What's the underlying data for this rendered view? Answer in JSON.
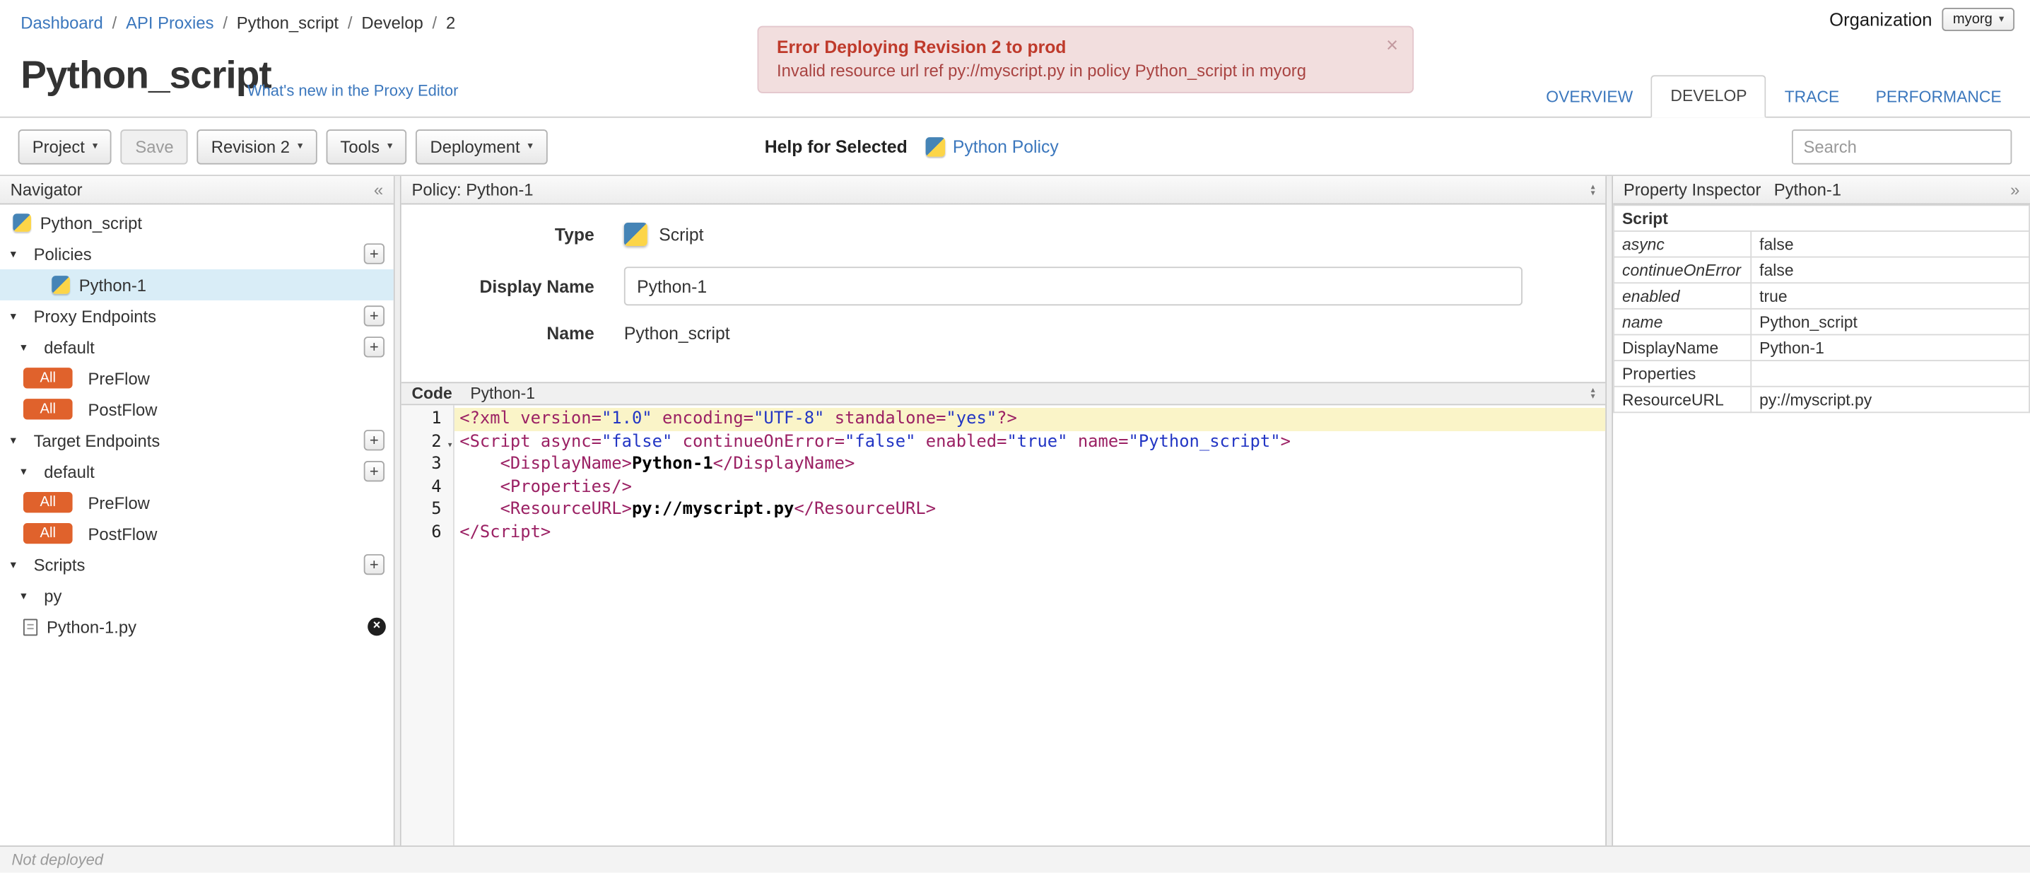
{
  "breadcrumb": {
    "separator": "/",
    "items": [
      {
        "label": "Dashboard",
        "link": true
      },
      {
        "label": "API Proxies",
        "link": true
      },
      {
        "label": "Python_script",
        "link": false
      },
      {
        "label": "Develop",
        "link": false
      },
      {
        "label": "2",
        "link": false
      }
    ]
  },
  "organization": {
    "label": "Organization",
    "value": "myorg"
  },
  "error_banner": {
    "title": "Error Deploying Revision 2 to prod",
    "message": "Invalid resource url ref py://myscript.py in policy Python_script in myorg",
    "close": "×"
  },
  "page": {
    "title": "Python_script",
    "whats_new": "What's new in the Proxy Editor"
  },
  "tabs": [
    {
      "label": "OVERVIEW",
      "active": false
    },
    {
      "label": "DEVELOP",
      "active": true
    },
    {
      "label": "TRACE",
      "active": false
    },
    {
      "label": "PERFORMANCE",
      "active": false
    }
  ],
  "toolbar": {
    "project": "Project",
    "save": "Save",
    "revision": "Revision 2",
    "tools": "Tools",
    "deployment": "Deployment",
    "help_label": "Help for Selected",
    "help_link": "Python Policy",
    "search_placeholder": "Search"
  },
  "navigator": {
    "title": "Navigator",
    "rows": [
      {
        "type": "item",
        "label": "Python_script"
      },
      {
        "type": "section",
        "label": "Policies",
        "plus": true
      },
      {
        "type": "policy",
        "label": "Python-1",
        "selected": true
      },
      {
        "type": "section",
        "label": "Proxy Endpoints",
        "plus": true
      },
      {
        "type": "subsection",
        "label": "default",
        "plus": true
      },
      {
        "type": "flow",
        "badge": "All",
        "label": "PreFlow"
      },
      {
        "type": "flow",
        "badge": "All",
        "label": "PostFlow"
      },
      {
        "type": "section",
        "label": "Target Endpoints",
        "plus": true
      },
      {
        "type": "subsection",
        "label": "default",
        "plus": true
      },
      {
        "type": "flow",
        "badge": "All",
        "label": "PreFlow"
      },
      {
        "type": "flow",
        "badge": "All",
        "label": "PostFlow"
      },
      {
        "type": "section",
        "label": "Scripts",
        "plus": true
      },
      {
        "type": "subsection",
        "label": "py",
        "plus": false
      },
      {
        "type": "file",
        "label": "Python-1.py",
        "closable": true
      }
    ]
  },
  "policy_panel": {
    "header": "Policy: Python-1",
    "type_label": "Type",
    "type_value": "Script",
    "display_name_label": "Display Name",
    "display_name_value": "Python-1",
    "name_label": "Name",
    "name_value": "Python_script"
  },
  "code_panel": {
    "label": "Code",
    "file": "Python-1",
    "lines": [
      {
        "n": 1,
        "active": true,
        "fold": false,
        "tokens": [
          {
            "c": "t",
            "v": "<?xml "
          },
          {
            "c": "a",
            "v": "version="
          },
          {
            "c": "s",
            "v": "\"1.0\""
          },
          {
            "c": "p",
            "v": " "
          },
          {
            "c": "a",
            "v": "encoding="
          },
          {
            "c": "s",
            "v": "\"UTF-8\""
          },
          {
            "c": "p",
            "v": " "
          },
          {
            "c": "a",
            "v": "standalone="
          },
          {
            "c": "s",
            "v": "\"yes\""
          },
          {
            "c": "t",
            "v": "?>"
          }
        ]
      },
      {
        "n": 2,
        "active": false,
        "fold": true,
        "tokens": [
          {
            "c": "t",
            "v": "<Script "
          },
          {
            "c": "a",
            "v": "async="
          },
          {
            "c": "s",
            "v": "\"false\""
          },
          {
            "c": "p",
            "v": " "
          },
          {
            "c": "a",
            "v": "continueOnError="
          },
          {
            "c": "s",
            "v": "\"false\""
          },
          {
            "c": "p",
            "v": " "
          },
          {
            "c": "a",
            "v": "enabled="
          },
          {
            "c": "s",
            "v": "\"true\""
          },
          {
            "c": "p",
            "v": " "
          },
          {
            "c": "a",
            "v": "name="
          },
          {
            "c": "s",
            "v": "\"Python_script\""
          },
          {
            "c": "t",
            "v": ">"
          }
        ]
      },
      {
        "n": 3,
        "active": false,
        "fold": false,
        "tokens": [
          {
            "c": "p",
            "v": "    "
          },
          {
            "c": "t",
            "v": "<DisplayName>"
          },
          {
            "c": "x",
            "v": "Python-1"
          },
          {
            "c": "t",
            "v": "</DisplayName>"
          }
        ]
      },
      {
        "n": 4,
        "active": false,
        "fold": false,
        "tokens": [
          {
            "c": "p",
            "v": "    "
          },
          {
            "c": "t",
            "v": "<Properties/>"
          }
        ]
      },
      {
        "n": 5,
        "active": false,
        "fold": false,
        "tokens": [
          {
            "c": "p",
            "v": "    "
          },
          {
            "c": "t",
            "v": "<ResourceURL>"
          },
          {
            "c": "x",
            "v": "py://myscript.py"
          },
          {
            "c": "t",
            "v": "</ResourceURL>"
          }
        ]
      },
      {
        "n": 6,
        "active": false,
        "fold": false,
        "tokens": [
          {
            "c": "t",
            "v": "</Script>"
          }
        ]
      }
    ]
  },
  "property_inspector": {
    "title": "Property Inspector",
    "subtitle": "Python-1",
    "rows": [
      {
        "key": "Script",
        "value": "",
        "header": true
      },
      {
        "key": "async",
        "value": "false",
        "italic": true
      },
      {
        "key": "continueOnError",
        "value": "false",
        "italic": true
      },
      {
        "key": "enabled",
        "value": "true",
        "italic": true
      },
      {
        "key": "name",
        "value": "Python_script",
        "italic": true
      },
      {
        "key": "DisplayName",
        "value": "Python-1"
      },
      {
        "key": "Properties",
        "value": ""
      },
      {
        "key": "ResourceURL",
        "value": "py://myscript.py"
      }
    ]
  },
  "status_bar": {
    "text": "Not deployed"
  }
}
